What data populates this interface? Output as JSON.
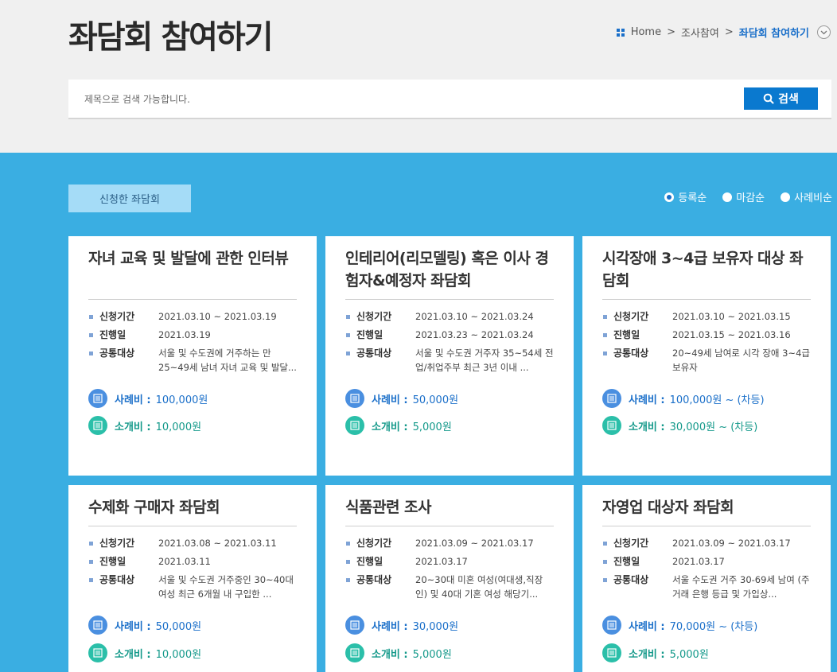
{
  "header": {
    "page_title": "좌담회 참여하기",
    "breadcrumb": [
      "Home",
      "조사참여",
      "좌담회 참여하기"
    ]
  },
  "search": {
    "placeholder": "제목으로 검색 가능합니다.",
    "button_label": "검색"
  },
  "tabs": {
    "applied_label": "신청한 좌담회"
  },
  "sort": {
    "options": [
      "등록순",
      "마감순",
      "사례비순"
    ],
    "selected": "등록순"
  },
  "labels": {
    "apply_period": "신청기간",
    "progress_date": "진행일",
    "target": "공통대상",
    "reward": "사례비 :",
    "referral": "소개비 :"
  },
  "colors": {
    "accent_blue": "#0a79cf",
    "section_bg": "#3aaee2",
    "reward_blue": "#1a6fc9",
    "referral_teal": "#14998a"
  },
  "cards": [
    {
      "title": "자녀 교육 및 발달에 관한 인터뷰",
      "apply_period": "2021.03.10 ~ 2021.03.19",
      "progress_date": "2021.03.19",
      "target": "서울 및 수도권에 거주하는 만 25~49세 남녀 자녀 교육 및 발달...",
      "reward": "100,000원",
      "referral": "10,000원"
    },
    {
      "title": "인테리어(리모델링) 혹은 이사 경험자&예정자 좌담회",
      "apply_period": "2021.03.10 ~ 2021.03.24",
      "progress_date": "2021.03.23 ~ 2021.03.24",
      "target": "서울 및 수도권 거주자 35~54세 전업/취업주부 최근 3년 이내 ...",
      "reward": "50,000원",
      "referral": "5,000원"
    },
    {
      "title": "시각장애 3~4급 보유자 대상 좌담회",
      "apply_period": "2021.03.10 ~ 2021.03.15",
      "progress_date": "2021.03.15 ~ 2021.03.16",
      "target": "20~49세 남여로 시각 장애 3~4급 보유자",
      "reward": "100,000원 ~ (차등)",
      "referral": "30,000원 ~ (차등)"
    },
    {
      "title": "수제화 구매자 좌담회",
      "apply_period": "2021.03.08 ~ 2021.03.11",
      "progress_date": "2021.03.11",
      "target": "서울 및 수도권 거주중인 30~40대 여성 최근 6개월 내 구입한 ...",
      "reward": "50,000원",
      "referral": "10,000원"
    },
    {
      "title": "식품관련 조사",
      "apply_period": "2021.03.09 ~ 2021.03.17",
      "progress_date": "2021.03.17",
      "target": "20~30대 미혼 여성(여대생,직장인) 및 40대 기혼 여성 해당기...",
      "reward": "30,000원",
      "referral": "5,000원"
    },
    {
      "title": "자영업 대상자 좌담회",
      "apply_period": "2021.03.09 ~ 2021.03.17",
      "progress_date": "2021.03.17",
      "target": "서울 수도권 거주 30-69세 남여 (주거래 은행 등급 및 가입상...",
      "reward": "70,000원 ~ (차등)",
      "referral": "5,000원"
    }
  ]
}
